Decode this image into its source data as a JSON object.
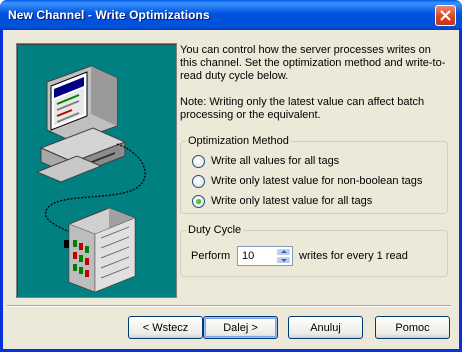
{
  "window": {
    "title": "New Channel - Write Optimizations"
  },
  "description": {
    "paragraph1": "You can control how the server processes writes on this channel.  Set the optimization method and write-to-read duty cycle below.",
    "paragraph2": "Note:  Writing only the latest value can affect batch processing or the equivalent."
  },
  "optimization": {
    "legend": "Optimization Method",
    "options": [
      {
        "label": "Write all values for all tags",
        "checked": false
      },
      {
        "label": "Write only latest value for non-boolean tags",
        "checked": false
      },
      {
        "label": "Write only latest value for all tags",
        "checked": true
      }
    ]
  },
  "duty_cycle": {
    "legend": "Duty Cycle",
    "prefix": "Perform",
    "value": "10",
    "suffix": "writes for every 1 read"
  },
  "buttons": {
    "back": "< Wstecz",
    "next": "Dalej >",
    "cancel": "Anuluj",
    "help": "Pomoc"
  },
  "icons": {
    "close": "close-icon",
    "illustration": "computer-and-device-illustration"
  },
  "colors": {
    "illustration_bg": "#008080",
    "titlebar": "#0054e3",
    "close_button": "#d4451e"
  }
}
